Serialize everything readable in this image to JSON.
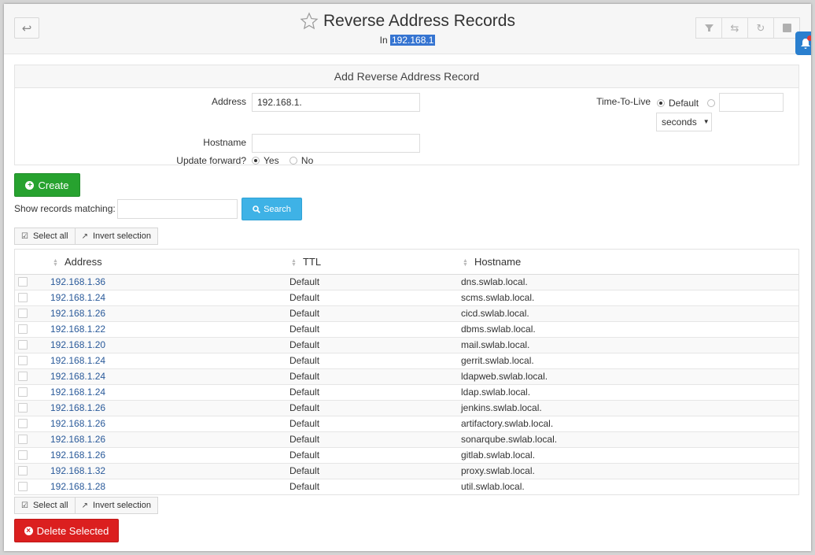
{
  "header": {
    "title": "Reverse Address Records",
    "subtitle_prefix": "In",
    "subtitle_value": "192.168.1"
  },
  "form": {
    "panel_title": "Add Reverse Address Record",
    "address_label": "Address",
    "address_value": "192.168.1.",
    "hostname_label": "Hostname",
    "hostname_value": "",
    "update_forward_label": "Update forward?",
    "update_yes": "Yes",
    "update_no": "No",
    "update_selected": "Yes",
    "ttl_label": "Time-To-Live",
    "ttl_default": "Default",
    "ttl_value": "",
    "ttl_unit": "seconds"
  },
  "actions": {
    "create_label": "Create",
    "show_label": "Show records matching:",
    "search_value": "",
    "search_label": "Search",
    "select_all": "Select all",
    "invert_selection": "Invert selection",
    "delete_label": "Delete Selected"
  },
  "table": {
    "columns": [
      "Address",
      "TTL",
      "Hostname"
    ],
    "rows": [
      {
        "address": "192.168.1.36",
        "ttl": "Default",
        "hostname": "dns.swlab.local."
      },
      {
        "address": "192.168.1.24",
        "ttl": "Default",
        "hostname": "scms.swlab.local."
      },
      {
        "address": "192.168.1.26",
        "ttl": "Default",
        "hostname": "cicd.swlab.local."
      },
      {
        "address": "192.168.1.22",
        "ttl": "Default",
        "hostname": "dbms.swlab.local."
      },
      {
        "address": "192.168.1.20",
        "ttl": "Default",
        "hostname": "mail.swlab.local."
      },
      {
        "address": "192.168.1.24",
        "ttl": "Default",
        "hostname": "gerrit.swlab.local."
      },
      {
        "address": "192.168.1.24",
        "ttl": "Default",
        "hostname": "ldapweb.swlab.local."
      },
      {
        "address": "192.168.1.24",
        "ttl": "Default",
        "hostname": "ldap.swlab.local."
      },
      {
        "address": "192.168.1.26",
        "ttl": "Default",
        "hostname": "jenkins.swlab.local."
      },
      {
        "address": "192.168.1.26",
        "ttl": "Default",
        "hostname": "artifactory.swlab.local."
      },
      {
        "address": "192.168.1.26",
        "ttl": "Default",
        "hostname": "sonarqube.swlab.local."
      },
      {
        "address": "192.168.1.26",
        "ttl": "Default",
        "hostname": "gitlab.swlab.local."
      },
      {
        "address": "192.168.1.32",
        "ttl": "Default",
        "hostname": "proxy.swlab.local."
      },
      {
        "address": "192.168.1.28",
        "ttl": "Default",
        "hostname": "util.swlab.local."
      }
    ]
  },
  "icons": {
    "back": "back-arrow-icon",
    "star": "star-icon",
    "filter": "filter-icon",
    "transfer": "transfer-icon",
    "refresh": "refresh-icon",
    "stop": "stop-icon",
    "bell": "bell-icon"
  },
  "colors": {
    "create": "#27a22f",
    "search": "#3eb2e6",
    "delete": "#db1f1f",
    "link": "#2a5a9a",
    "highlight": "#3574d1"
  }
}
